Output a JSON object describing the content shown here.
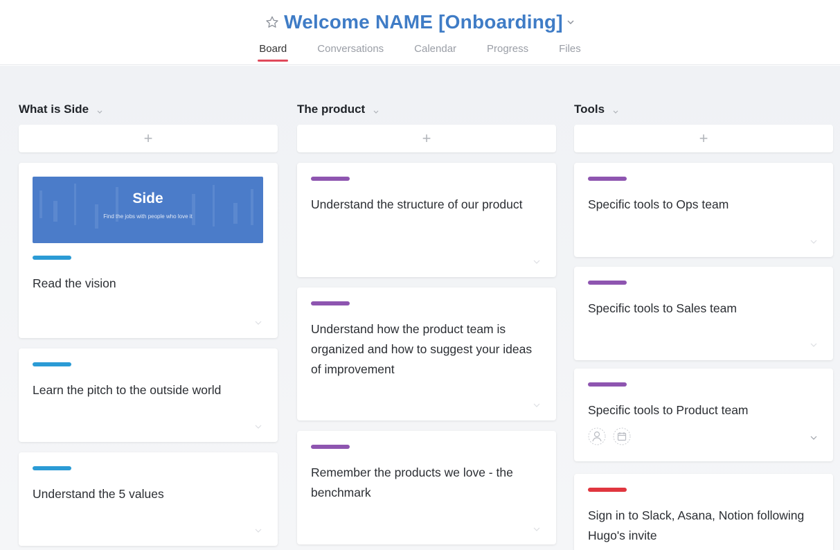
{
  "header": {
    "title": "Welcome NAME [Onboarding]",
    "tabs": [
      {
        "label": "Board",
        "active": true
      },
      {
        "label": "Conversations",
        "active": false
      },
      {
        "label": "Calendar",
        "active": false
      },
      {
        "label": "Progress",
        "active": false
      },
      {
        "label": "Files",
        "active": false
      }
    ]
  },
  "colors": {
    "title_blue": "#3f7cc6",
    "tab_active_underline": "#e0495a",
    "tag_blue": "#2b9bd5",
    "tag_purple": "#8e55b0",
    "tag_red": "#e0363f"
  },
  "columns": [
    {
      "title": "What is Side",
      "add_label": "+",
      "cards": [
        {
          "title": "Read the vision",
          "tag_color": "#2b9bd5",
          "cover": {
            "title": "Side",
            "subtitle": "Find the jobs with people who love it"
          }
        },
        {
          "title": "Learn the pitch to the outside world",
          "tag_color": "#2b9bd5"
        },
        {
          "title": "Understand the 5 values",
          "tag_color": "#2b9bd5"
        }
      ]
    },
    {
      "title": "The product",
      "add_label": "+",
      "cards": [
        {
          "title": "Understand the structure of our product",
          "tag_color": "#8e55b0"
        },
        {
          "title": "Understand how the product team is organized and how to suggest your ideas of improvement",
          "tag_color": "#8e55b0"
        },
        {
          "title": "Remember the products we love - the benchmark",
          "tag_color": "#8e55b0"
        }
      ]
    },
    {
      "title": "Tools",
      "add_label": "+",
      "cards": [
        {
          "title": "Specific tools to Ops team",
          "tag_color": "#8e55b0"
        },
        {
          "title": "Specific tools to Sales team",
          "tag_color": "#8e55b0"
        },
        {
          "title": "Specific tools to Product team",
          "tag_color": "#8e55b0",
          "icons": [
            "assignee-icon",
            "due-date-icon"
          ]
        },
        {
          "title": "Sign in to Slack, Asana, Notion following Hugo's invite",
          "tag_color": "#e0363f"
        }
      ]
    }
  ]
}
